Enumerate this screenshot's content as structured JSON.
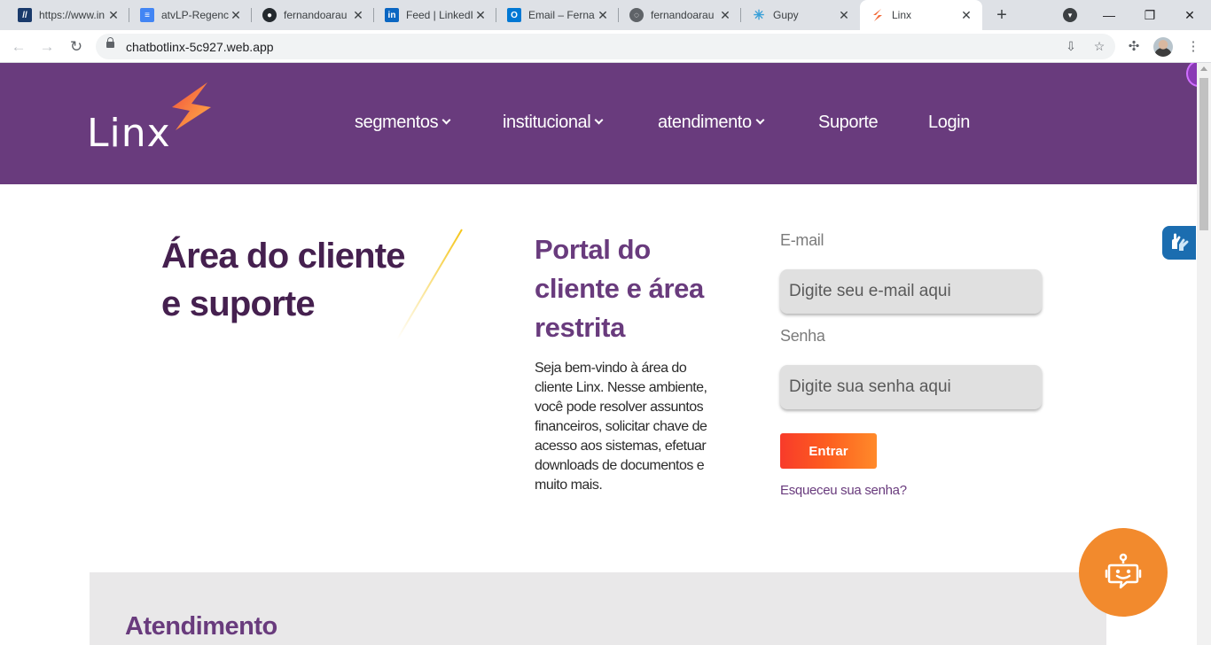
{
  "browser": {
    "tabs": [
      {
        "title": "https://www.in",
        "icon": "ie-logo-icon"
      },
      {
        "title": "atvLP-Regenc",
        "icon": "google-docs-icon"
      },
      {
        "title": "fernandoarau",
        "icon": "github-icon"
      },
      {
        "title": "Feed | LinkedI",
        "icon": "linkedin-icon"
      },
      {
        "title": "Email – Ferna",
        "icon": "outlook-icon"
      },
      {
        "title": "fernandoarau",
        "icon": "globe-icon"
      },
      {
        "title": "Gupy",
        "icon": "gupy-icon"
      },
      {
        "title": "Linx",
        "icon": "linx-icon",
        "active": true
      }
    ],
    "url": "chatbotlinx-5c927.web.app"
  },
  "site": {
    "logo_text": "Linx",
    "nav": [
      {
        "label": "segmentos",
        "dropdown": true
      },
      {
        "label": "institucional",
        "dropdown": true
      },
      {
        "label": "atendimento",
        "dropdown": true
      },
      {
        "label": "Suporte",
        "dropdown": false
      },
      {
        "label": "Login",
        "dropdown": false
      }
    ],
    "hero": {
      "title_line1": "Área do cliente",
      "title_line2": "e suporte"
    },
    "portal": {
      "title_line1": "Portal do",
      "title_line2": "cliente e área",
      "title_line3": "restrita",
      "description": "Seja bem-vindo à área do cliente Linx. Nesse ambiente, você pode resolver assuntos financeiros, solicitar chave de acesso aos sistemas, efetuar downloads de documentos e muito mais."
    },
    "login_form": {
      "email_label": "E-mail",
      "email_placeholder": "Digite seu e-mail aqui",
      "password_label": "Senha",
      "password_placeholder": "Digite sua senha aqui",
      "submit_label": "Entrar",
      "forgot_label": "Esqueceu sua senha?"
    },
    "atendimento_title": "Atendimento"
  },
  "colors": {
    "header_purple": "#693b7d",
    "title_dark_purple": "#45204f",
    "button_gradient_start": "#f83b2a",
    "button_gradient_end": "#ff8a2a",
    "chatbot_orange": "#f28a2d",
    "accessibility_blue": "#1b6db0"
  }
}
